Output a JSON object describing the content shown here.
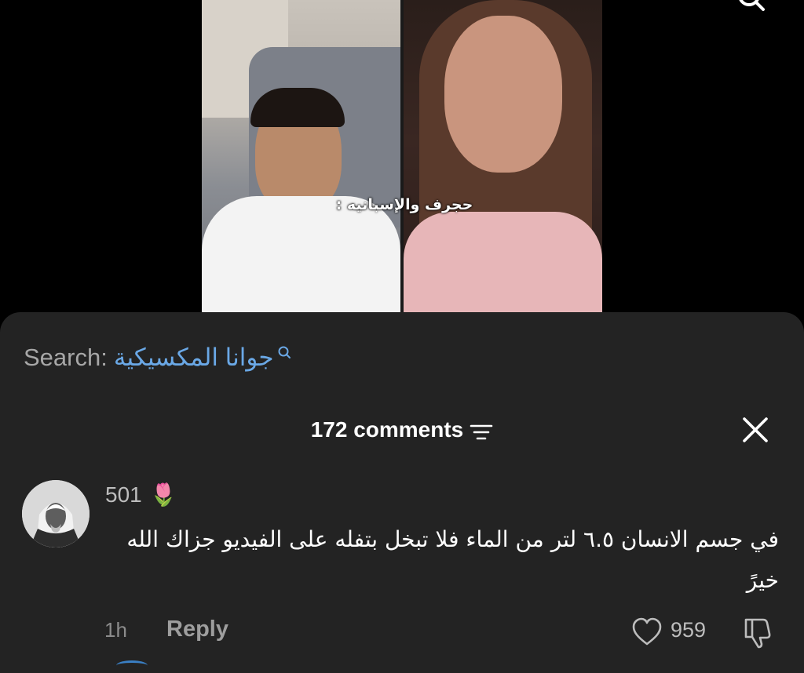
{
  "video": {
    "caption": "حجرف والإسبانيه :"
  },
  "search": {
    "label": "Search:",
    "query": "جوانا المكسيكية"
  },
  "comments": {
    "count_label": "172 comments"
  },
  "comment": {
    "username": "501",
    "emoji": "🌷",
    "text": "في جسم الانسان ٦.٥ لتر من الماء فلا تبخل بتفله على الفيديو جزاك الله خيرً",
    "time": "1h",
    "reply_label": "Reply",
    "likes": "959"
  },
  "colors": {
    "sheet_bg": "#232323",
    "search_query": "#6aa8e6"
  }
}
